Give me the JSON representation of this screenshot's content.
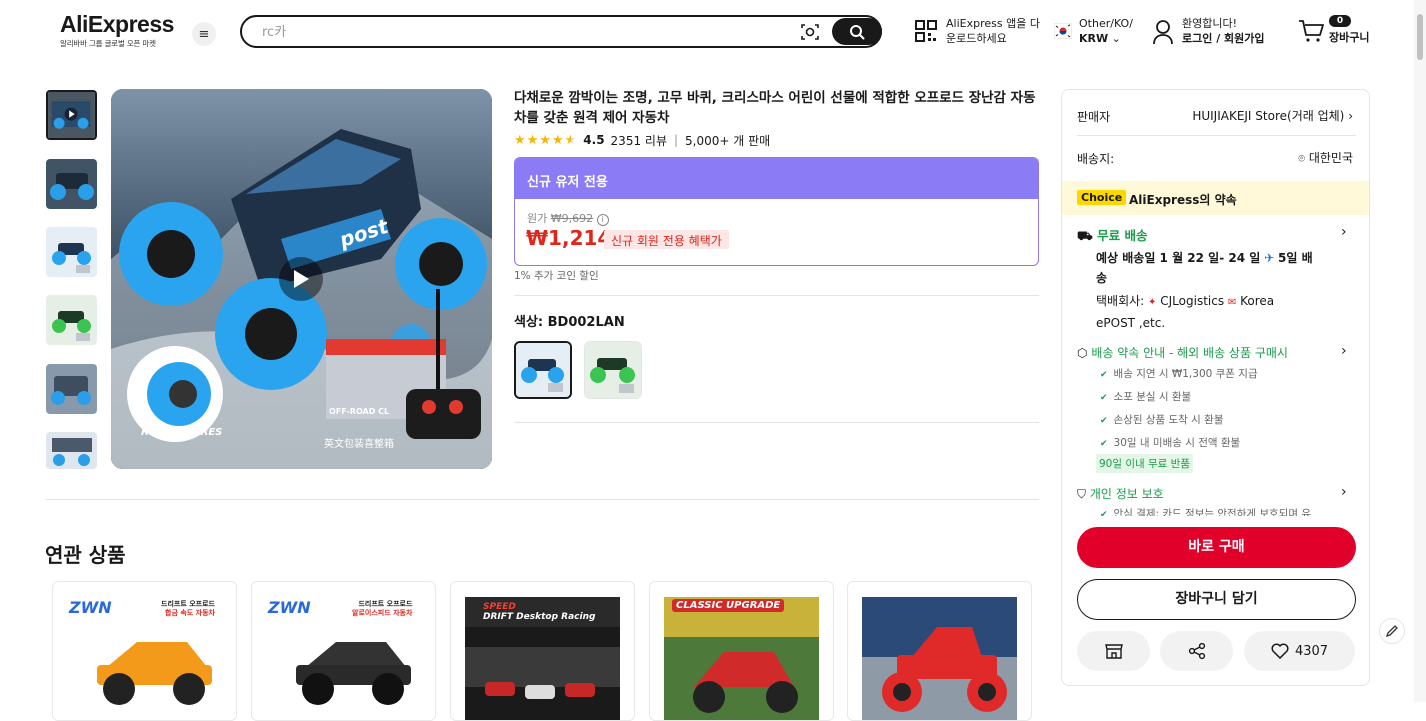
{
  "header": {
    "logo": "AliExpress",
    "logo_sub": "알리바바 그룹 글로벌 오픈 마켓",
    "search_placeholder": "rc카",
    "app_line1": "AliExpress 앱을 다",
    "app_line2": "운로드하세요",
    "region_line1": "Other/KO/",
    "region_line2": "KRW",
    "login_line1": "환영합니다!",
    "login_line2": "로그인 / 회원가입",
    "cart_count": "0",
    "cart_label": "장바구니"
  },
  "product": {
    "title": "다채로운 깜박이는 조명, 고무 바퀴, 크리스마스 어린이 선물에 적합한 오프로드 장난감 자동차를 갖춘 원격 제어 자동차",
    "rating": "4.5",
    "rating_value": 4.5,
    "reviews": "2351 리뷰",
    "sold": "5,000+ 개 판매",
    "promo_head": "신규 유저 전용",
    "orig_label": "원가",
    "orig_price": "₩9,692",
    "price": "₩1,214",
    "price_badge": "신규 회원 전용 혜택가",
    "coin_note": "1% 추가 코인 할인",
    "color_label": "색상: BD002LAN",
    "main_img_text_1": "RUBBER TIRES",
    "main_img_text_2": "英文包装喜整箱",
    "main_img_text_3": "OFF-ROAD CL",
    "main_img_text_4": "post"
  },
  "related": {
    "title": "연관 상품",
    "cards": [
      {
        "brand": "ZWN",
        "caption_1": "드리프트 오프로드",
        "caption_2": "합금 속도 자동차"
      },
      {
        "brand": "ZWN",
        "caption_1": "드리프트 오프로드",
        "caption_2": "알로이스피드 자동차"
      },
      {
        "caption_1": "SPEED",
        "caption_2": "DRIFT Desktop Racing"
      },
      {
        "caption_1": "CLASSIC UPGRADE"
      },
      {
        "caption_1": ""
      }
    ]
  },
  "panel": {
    "seller_label": "판매자",
    "seller_value": "HUIJIAKEJI Store(거래 업체)",
    "ship_label": "배송지:",
    "ship_value": "대한민국",
    "choice_tag": "Choice",
    "choice_text": "AliExpress의 약속",
    "free_ship": "무료 배송",
    "eta_1": "예상 배송일 1 월 22 일- 24 일",
    "eta_2": "5일 배",
    "eta_3": "송",
    "courier_1": "택배회사:",
    "courier_2": "CJLogistics",
    "courier_3": "Korea",
    "courier_4": "ePOST ,etc.",
    "guarantee": "배송 약속 안내 - 해외 배송 상품 구매시",
    "checks": [
      "배송 지연 시 ₩1,300 쿠폰 지급",
      "소포 분실 시 환불",
      "손상된 상품 도착 시 환불",
      "30일 내 미배송 시 전액 환불"
    ],
    "return_badge": "90일 이내 무료 반품",
    "privacy": "개인 정보 보호",
    "privacy_sub": "안심 결제: 카드 정보는 안전하게 보호되며 유",
    "buy_now": "바로 구매",
    "add_cart": "장바구니 담기",
    "wish_count": "4307"
  }
}
